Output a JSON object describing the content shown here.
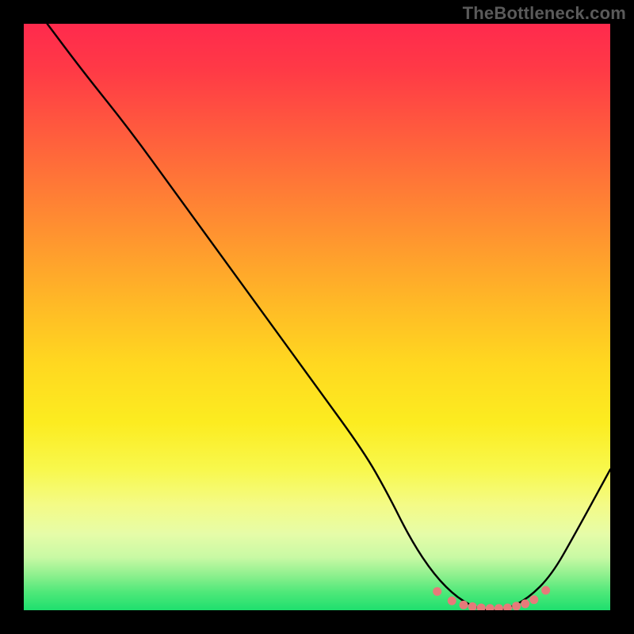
{
  "watermark": "TheBottleneck.com",
  "chart_data": {
    "type": "line",
    "title": "",
    "xlabel": "",
    "ylabel": "",
    "xlim": [
      0,
      100
    ],
    "ylim": [
      0,
      100
    ],
    "series": [
      {
        "name": "curve",
        "x": [
          4,
          10,
          18,
          26,
          34,
          42,
          50,
          58,
          62,
          66,
          70,
          74,
          78,
          82,
          86,
          90,
          94,
          100
        ],
        "y": [
          100,
          92,
          82,
          71,
          60,
          49,
          38,
          27,
          20,
          12,
          6,
          2,
          0,
          0,
          2,
          6,
          13,
          24
        ]
      }
    ],
    "markers": {
      "name": "bottom-dots",
      "color": "#e77a7a",
      "x": [
        70.5,
        73,
        75,
        76.5,
        78,
        79.5,
        81,
        82.5,
        84,
        85.5,
        87,
        89
      ],
      "y": [
        3.2,
        1.6,
        0.9,
        0.6,
        0.4,
        0.3,
        0.3,
        0.4,
        0.7,
        1.1,
        1.8,
        3.4
      ]
    },
    "gradient_stops": [
      {
        "pct": 0,
        "color": "#ff2a4d"
      },
      {
        "pct": 18,
        "color": "#ff5a3e"
      },
      {
        "pct": 38,
        "color": "#ff9a2e"
      },
      {
        "pct": 58,
        "color": "#ffd820"
      },
      {
        "pct": 76,
        "color": "#f8f84d"
      },
      {
        "pct": 91,
        "color": "#c8f9a4"
      },
      {
        "pct": 100,
        "color": "#1fdf6e"
      }
    ]
  }
}
